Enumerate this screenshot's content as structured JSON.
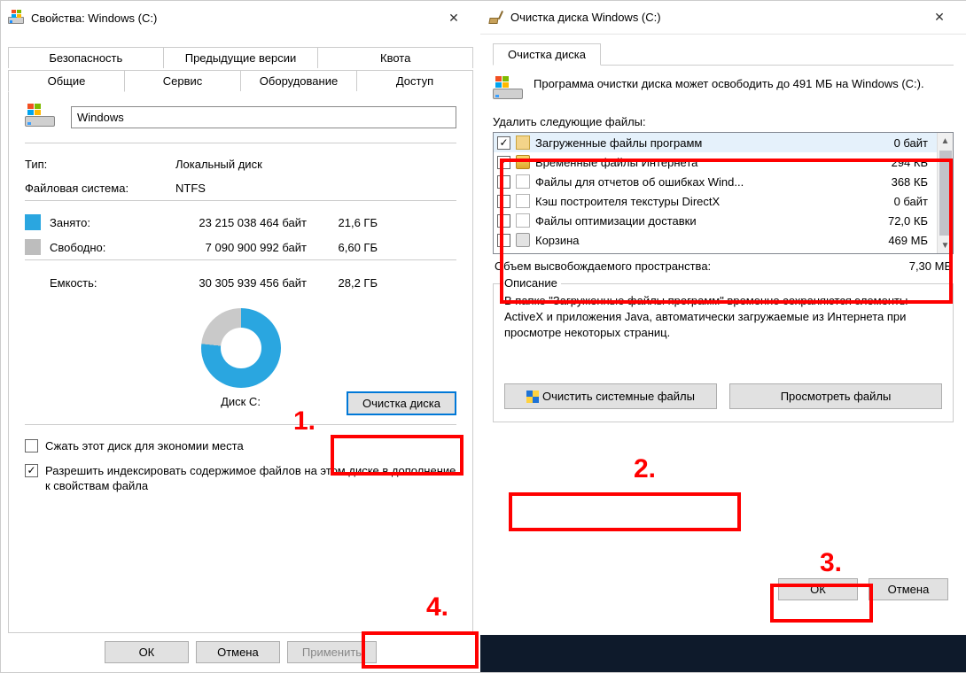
{
  "left": {
    "title": "Свойства: Windows (C:)",
    "tabs_top": [
      "Безопасность",
      "Предыдущие версии",
      "Квота"
    ],
    "tabs_bottom": [
      "Общие",
      "Сервис",
      "Оборудование",
      "Доступ"
    ],
    "active_tab": "Общие",
    "name_value": "Windows",
    "type_label": "Тип:",
    "type_value": "Локальный диск",
    "fs_label": "Файловая система:",
    "fs_value": "NTFS",
    "used_label": "Занято:",
    "used_bytes": "23 215 038 464 байт",
    "used_gb": "21,6 ГБ",
    "free_label": "Свободно:",
    "free_bytes": "7 090 900 992 байт",
    "free_gb": "6,60 ГБ",
    "cap_label": "Емкость:",
    "cap_bytes": "30 305 939 456 байт",
    "cap_gb": "28,2 ГБ",
    "disk_label": "Диск C:",
    "cleanup_btn": "Очистка диска",
    "compress_label": "Сжать этот диск для экономии места",
    "index_label": "Разрешить индексировать содержимое файлов на этом диске в дополнение к свойствам файла",
    "ok": "ОК",
    "cancel": "Отмена",
    "apply": "Применить"
  },
  "right": {
    "title": "Очистка диска Windows (C:)",
    "tab": "Очистка диска",
    "info_text": "Программа очистки диска может освободить до 491 МБ на Windows (C:).",
    "del_label": "Удалить следующие файлы:",
    "files": [
      {
        "checked": true,
        "icon": "folder",
        "name": "Загруженные файлы программ",
        "size": "0 байт",
        "selected": true
      },
      {
        "checked": true,
        "icon": "lock",
        "name": "Временные файлы Интернета",
        "size": "294 КБ"
      },
      {
        "checked": false,
        "icon": "file",
        "name": "Файлы для отчетов об ошибках Wind...",
        "size": "368 КБ"
      },
      {
        "checked": false,
        "icon": "file",
        "name": "Кэш построителя текстуры DirectX",
        "size": "0 байт"
      },
      {
        "checked": false,
        "icon": "file",
        "name": "Файлы оптимизации доставки",
        "size": "72,0 КБ"
      },
      {
        "checked": false,
        "icon": "trash",
        "name": "Корзина",
        "size": "469 МБ"
      }
    ],
    "total_label": "Объем высвобождаемого пространства:",
    "total_value": "7,30 МБ",
    "group_title": "Описание",
    "desc_text": "В папке \"Загруженные файлы программ\" временно сохраняются элементы ActiveX и приложения Java, автоматически загружаемые из Интернета при просмотре некоторых страниц.",
    "clean_sys": "Очистить системные файлы",
    "view_files": "Просмотреть файлы",
    "ok": "ОК",
    "cancel": "Отмена"
  },
  "annotations": {
    "a1": "1.",
    "a2": "2.",
    "a3": "3.",
    "a4": "4."
  }
}
